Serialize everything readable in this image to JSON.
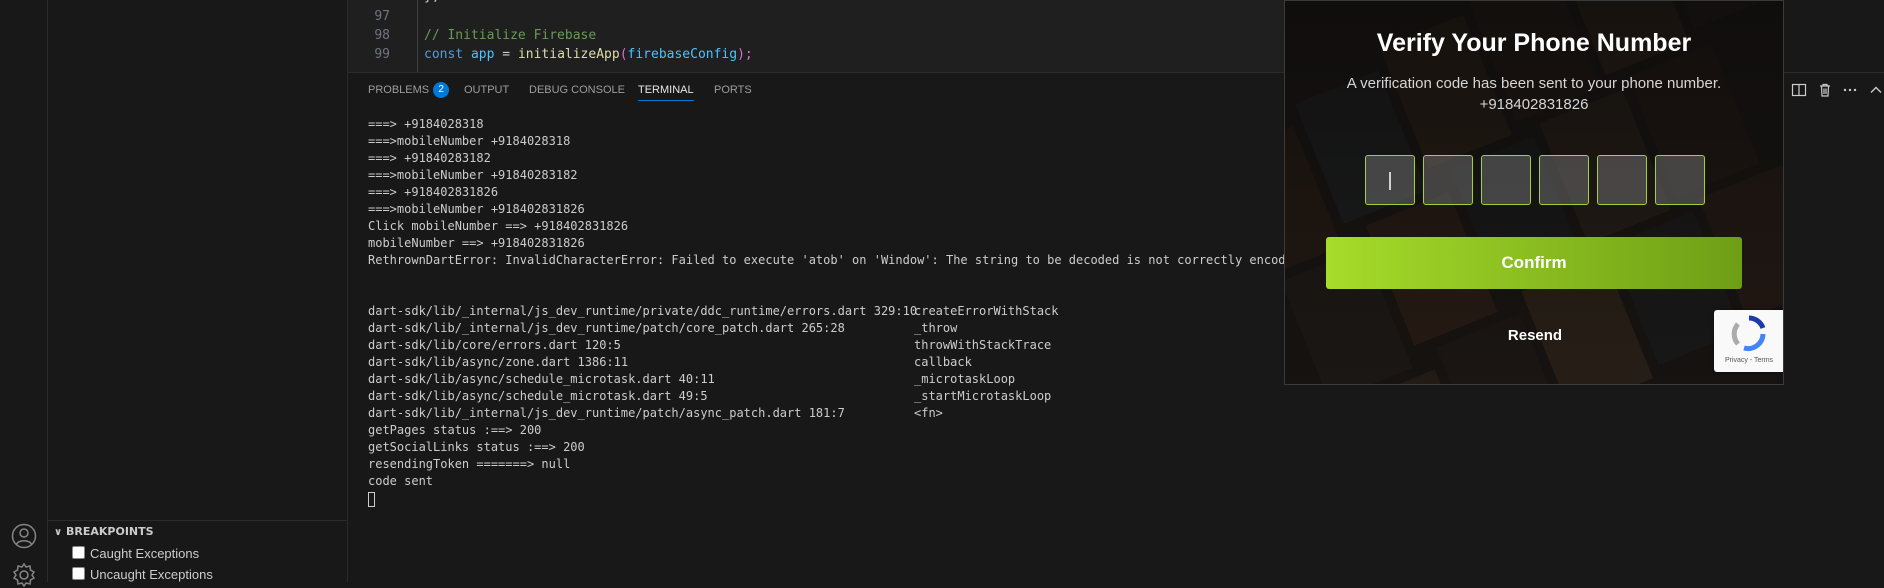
{
  "editor": {
    "lines": [
      {
        "num": "97",
        "text": ""
      },
      {
        "num": "98",
        "comment": "// Initialize Firebase"
      },
      {
        "num": "99",
        "kw": "const",
        "var": "app",
        "eq": " = ",
        "fn": "initializeApp",
        "open": "(",
        "arg": "firebaseConfig",
        "close": ");"
      }
    ]
  },
  "panel": {
    "tabs": [
      {
        "label": "PROBLEMS",
        "badge": "2"
      },
      {
        "label": "OUTPUT"
      },
      {
        "label": "DEBUG CONSOLE"
      },
      {
        "label": "TERMINAL"
      },
      {
        "label": "PORTS"
      }
    ],
    "active_tab": "TERMINAL"
  },
  "terminal": {
    "lines": [
      "===> +9184028318",
      "===>mobileNumber +9184028318",
      "===> +91840283182",
      "===>mobileNumber +91840283182",
      "===> +918402831826",
      "===>mobileNumber +918402831826",
      "Click mobileNumber ==> +918402831826",
      "mobileNumber ==> +918402831826",
      "RethrownDartError: InvalidCharacterError: Failed to execute 'atob' on 'Window': The string to be decoded is not correctly encoded.",
      "",
      "",
      "dart-sdk/lib/_internal/js_dev_runtime/private/ddc_runtime/errors.dart 329:10",
      "dart-sdk/lib/_internal/js_dev_runtime/patch/core_patch.dart 265:28",
      "dart-sdk/lib/core/errors.dart 120:5",
      "dart-sdk/lib/async/zone.dart 1386:11",
      "dart-sdk/lib/async/schedule_microtask.dart 40:11",
      "dart-sdk/lib/async/schedule_microtask.dart 49:5",
      "dart-sdk/lib/_internal/js_dev_runtime/patch/async_patch.dart 181:7",
      "getPages status :==> 200",
      "getSocialLinks status :==> 200",
      "resendingToken =======> null",
      "code sent"
    ],
    "stack_functions": [
      "createErrorWithStack",
      "_throw",
      "throwWithStackTrace",
      "callback",
      "_microtaskLoop",
      "_startMicrotaskLoop",
      "<fn>"
    ]
  },
  "breakpoints": {
    "header": "BREAKPOINTS",
    "items": [
      {
        "label": "Caught Exceptions",
        "checked": false
      },
      {
        "label": "Uncaught Exceptions",
        "checked": false
      }
    ]
  },
  "modal": {
    "title": "Verify Your Phone Number",
    "subtitle": "A verification code has been sent to your phone number.",
    "phone": "+918402831826",
    "otp_length": 6,
    "confirm_label": "Confirm",
    "resend_label": "Resend",
    "recaptcha_text": "Privacy - Terms",
    "accent_color": "#a6dc2a"
  },
  "icons": {
    "activity": [
      "account-icon",
      "settings-gear-icon"
    ],
    "panel_actions": [
      "split-terminal-icon",
      "trash-icon",
      "more-icon",
      "chevron-up-icon"
    ]
  }
}
